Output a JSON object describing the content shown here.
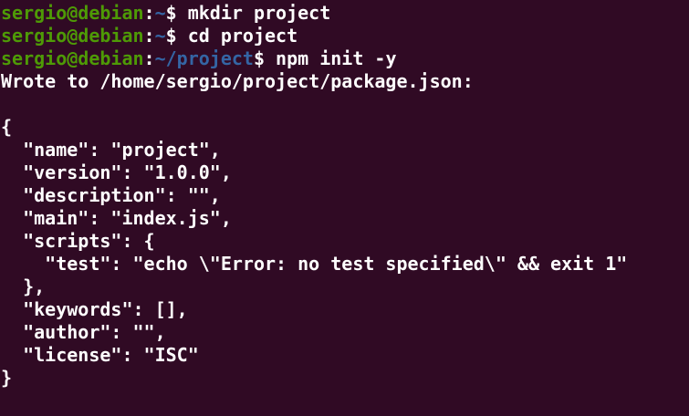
{
  "colors": {
    "background": "#300a24",
    "text": "#ffffff",
    "prompt_user": "#4e9a06",
    "prompt_path": "#3465a4"
  },
  "terminal": {
    "top_fragment": "'",
    "prompts": [
      {
        "user_host": "sergio@debian",
        "sep": ":",
        "path": "~",
        "dollar": "$",
        "command": " mkdir project"
      },
      {
        "user_host": "sergio@debian",
        "sep": ":",
        "path": "~",
        "dollar": "$",
        "command": " cd project"
      },
      {
        "user_host": "sergio@debian",
        "sep": ":",
        "path": "~/project",
        "dollar": "$",
        "command": " npm init -y"
      }
    ],
    "output": [
      "Wrote to /home/sergio/project/package.json:",
      "",
      "{",
      "  \"name\": \"project\",",
      "  \"version\": \"1.0.0\",",
      "  \"description\": \"\",",
      "  \"main\": \"index.js\",",
      "  \"scripts\": {",
      "    \"test\": \"echo \\\"Error: no test specified\\\" && exit 1\"",
      "  },",
      "  \"keywords\": [],",
      "  \"author\": \"\",",
      "  \"license\": \"ISC\"",
      "}"
    ]
  }
}
